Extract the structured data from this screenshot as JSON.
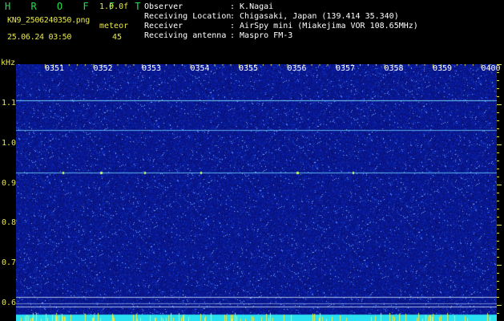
{
  "header": {
    "brand": "H R O F F T",
    "version": "1.0.0f",
    "filename": "KN9_2506240350.png",
    "meteor_label": "meteor",
    "date_time": "25.06.24 03:50",
    "meteor_count": "45"
  },
  "info": [
    {
      "key": "Observer",
      "value": ": K.Nagai"
    },
    {
      "key": "Receiving Location",
      "value": ": Chigasaki, Japan (139.414 35.340)"
    },
    {
      "key": "Receiver",
      "value": ": AirSpy mini (Miakejima VOR 108.65MHz)"
    },
    {
      "key": "Receiving antenna",
      "value": ": Maspro FM-3"
    }
  ],
  "axes": {
    "y_unit": "kHz",
    "y_ticks": [
      "1.1",
      "1.0",
      "0.9",
      "0.8",
      "0.7",
      "0.6"
    ],
    "x_ticks": [
      "0351",
      "0352",
      "0353",
      "0354",
      "0355",
      "0356",
      "0357",
      "0358",
      "0359",
      "0400"
    ]
  },
  "colors": {
    "background": "#000000",
    "spectrogram": "#0a1aa0",
    "label_yellow": "#e8e84a",
    "brand_green": "#22e04a",
    "info_white": "#ffffff",
    "baseline_cyan": "#28e0f0"
  }
}
